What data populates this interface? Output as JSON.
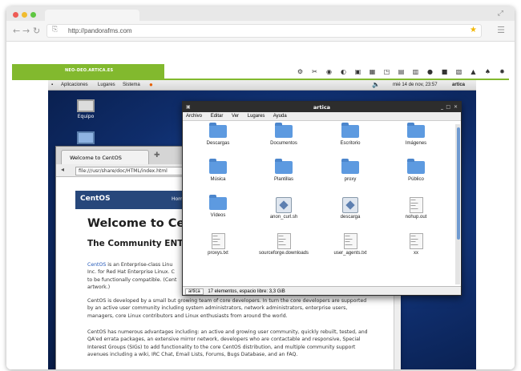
{
  "browser": {
    "url": "http://pandorafms.com"
  },
  "pandora": {
    "tab_label": "NEO-DEO.ARTICA.ES",
    "toolbar_icons": [
      "network-icon",
      "tools-icon",
      "wifi-icon",
      "toggle-icon",
      "screen-icon",
      "grid-icon",
      "window-icon",
      "monitor-icon",
      "display-icon",
      "pin-icon",
      "folder-icon",
      "file-icon",
      "lock-icon",
      "bell-icon",
      "gear-icon"
    ]
  },
  "desktop": {
    "panel": {
      "apps": "Aplicaciones",
      "places": "Lugares",
      "system": "Sistema",
      "datetime": "mié 14 de nov, 23:57",
      "user": "artica"
    },
    "icon_label": "Equipo"
  },
  "firefox": {
    "tab_title": "Welcome to CentOS",
    "url": "file:///usr/share/doc/HTML/index.html",
    "logo": "CentOS",
    "nav_home": "Hom",
    "h1": "Welcome to Cent",
    "h2": "The Community ENTerp",
    "paragraphs": [
      [
        "CentOS",
        " is an Enterprise-class Linu"
      ],
      [
        "Inc. for Red Hat Enterprise Linux. C"
      ],
      [
        "to be functionally compatible. (Cent"
      ],
      [
        "artwork.)"
      ]
    ],
    "p2": [
      "CentOS is developed by a small but growing team of core developers.  In turn the core developers are supported",
      "by an active user community including system administrators, network administrators, enterprise users,",
      "managers, core Linux contributors and Linux enthusiasts from around the world."
    ],
    "p3": [
      "CentOS has numerous advantages including: an active and growing user community, quickly rebuilt, tested, and",
      "QA'ed errata packages, an extensive mirror network, developers who are contactable and responsive, Special",
      "Interest Groups (SIGs) to add functionality to the core CentOS distribution, and multiple community support",
      "avenues including a wiki, IRC Chat, Email Lists, Forums, Bugs Database, and an FAQ."
    ]
  },
  "nautilus": {
    "title": "artica",
    "menu": [
      "Archivo",
      "Editar",
      "Ver",
      "Lugares",
      "Ayuda"
    ],
    "items": [
      {
        "label": "Descargas",
        "kind": "folder"
      },
      {
        "label": "Documentos",
        "kind": "folder"
      },
      {
        "label": "Escritorio",
        "kind": "folder"
      },
      {
        "label": "Imágenes",
        "kind": "folder"
      },
      {
        "label": "Música",
        "kind": "folder"
      },
      {
        "label": "Plantillas",
        "kind": "folder"
      },
      {
        "label": "proxy",
        "kind": "folder"
      },
      {
        "label": "Público",
        "kind": "folder"
      },
      {
        "label": "Vídeos",
        "kind": "folder"
      },
      {
        "label": "anon_curl.sh",
        "kind": "script"
      },
      {
        "label": "descarga",
        "kind": "script"
      },
      {
        "label": "nohup.out",
        "kind": "doc"
      },
      {
        "label": "proxys.txt",
        "kind": "doc"
      },
      {
        "label": "sourceforge.downloads",
        "kind": "doc"
      },
      {
        "label": "user_agents.txt",
        "kind": "doc"
      },
      {
        "label": "xx",
        "kind": "doc"
      }
    ],
    "status_location": "artica",
    "status_text": "17 elementos, espacio libre: 3,3 GiB"
  }
}
